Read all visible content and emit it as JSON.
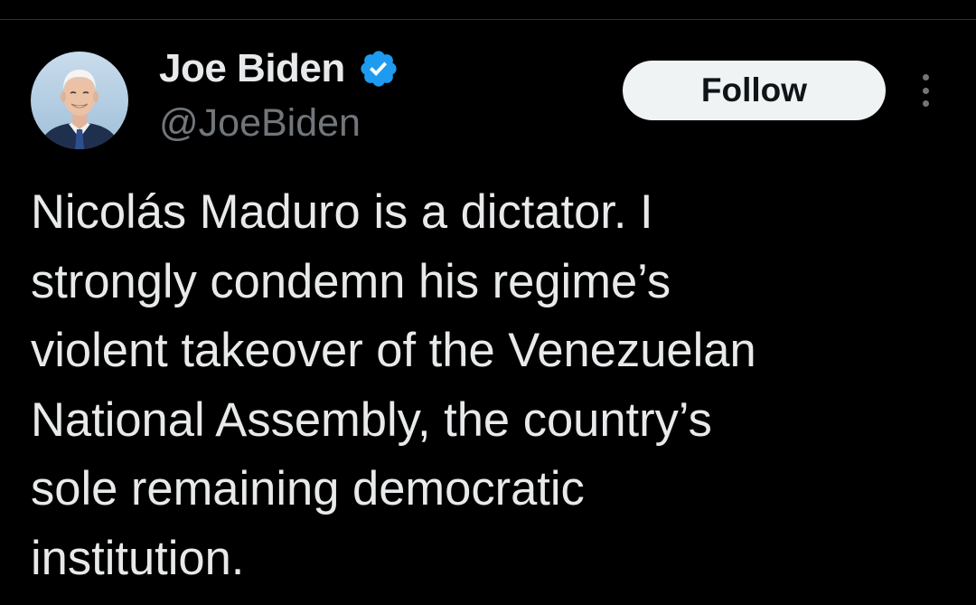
{
  "tweet": {
    "author": {
      "display_name": "Joe Biden",
      "handle": "@JoeBiden",
      "verified": true,
      "verified_icon": "verified-badge-icon",
      "avatar": "profile-avatar"
    },
    "follow_label": "Follow",
    "more_icon": "more-options-icon",
    "text": "Nicolás Maduro is a dictator. I\nstrongly condemn his regime’s\nviolent takeover of the Venezuelan\nNational Assembly, the country’s\nsole remaining democratic\ninstitution."
  },
  "colors": {
    "background": "#000000",
    "primary_text": "#e7e9ea",
    "secondary_text": "#71767b",
    "verified_blue": "#1d9bf0",
    "follow_button_bg": "#eff3f4",
    "follow_button_text": "#0f1419",
    "divider": "#2f3336"
  }
}
